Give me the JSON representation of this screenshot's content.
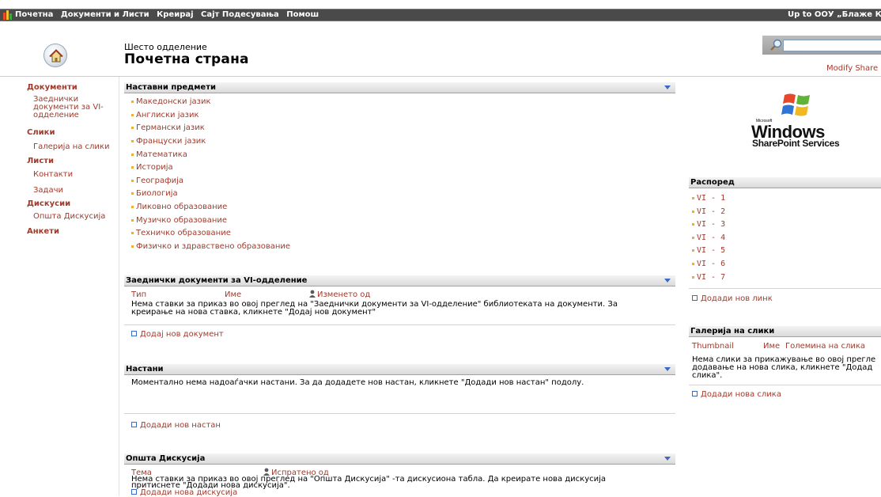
{
  "topbar": {
    "nav": [
      "Почетна",
      "Документи и Листи",
      "Креирај",
      "Сајт Подесувања",
      "Помош"
    ],
    "upto": "Up to ООУ „Блаже К"
  },
  "header": {
    "subtitle": "Шесто одделение",
    "title": "Почетна страна",
    "modify_link": "Modify Share"
  },
  "leftnav": {
    "sections": [
      {
        "label": "Документи",
        "items": [
          "Заеднички",
          "документи за VI-",
          "одделение"
        ]
      },
      {
        "label": "Слики",
        "items": [
          "Галерија на слики"
        ]
      },
      {
        "label": "Листи",
        "items": [
          "Контакти",
          "Задачи"
        ]
      },
      {
        "label": "Дискусии",
        "items": [
          "Општа Дискусија"
        ]
      },
      {
        "label": "Анкети",
        "items": []
      }
    ]
  },
  "subjects": {
    "title": "Наставни предмети",
    "items": [
      "Македонски јазик",
      "Англиски јазик",
      "Германски јазик",
      "Француски јазик",
      "Математика",
      "Историја",
      "Географија",
      "Биологија",
      "Ликовно образование",
      "Музичко образование",
      "Техничко образование",
      "Физичко и здравствено образование"
    ]
  },
  "shared_docs": {
    "title": "Заеднички документи за VI-одделение",
    "col_type": "Тип",
    "col_name": "Име",
    "col_modified": "Изменето од",
    "message_line1": "Нема ставки за приказ во овој преглед на \"Заеднички документи за VI-одделение\" библиотеката на документи. За",
    "message_line2": "креирање на нова ставка, кликнете \"Додај нов документ\"",
    "add_link": "Додај нов документ"
  },
  "events": {
    "title": "Настани",
    "message": "Моментално нема надоаѓачки настани. За да додадете нов настан, кликнете \"Додади нов настан\" подолу.",
    "add_link": "Додади нов настан"
  },
  "discussion": {
    "title": "Општа Дискусија",
    "col_topic": "Тема",
    "col_sent": "Испратено од",
    "message_line1": "Нема ставки за приказ во овој преглед на \"Општа Дискусија\" -та дискусиона табла. Да креирате нова дискусија",
    "message_line2": "притиснете \"Додади нова дискусија\".",
    "add_link": "Додади нова дискусија"
  },
  "logo": {
    "microsoft": "Microsoft",
    "windows": "Windows",
    "product": "SharePoint Services"
  },
  "schedule": {
    "title": "Распоред",
    "items": [
      "VI - 1",
      "VI - 2",
      "VI - 3",
      "VI - 4",
      "VI - 5",
      "VI - 6",
      "VI - 7"
    ],
    "add_link": "Додади нов линк"
  },
  "gallery": {
    "title": "Галерија на слики",
    "col_thumb": "Thumbnail",
    "col_name": "Име",
    "col_size": "Големина на слика",
    "message_line1": "Нема слики за прикажување во овој прегле",
    "message_line2": "додавање на нова слика, кликнете \"Додад",
    "message_line3": "слика\".",
    "add_link": "Додади нова слика"
  }
}
